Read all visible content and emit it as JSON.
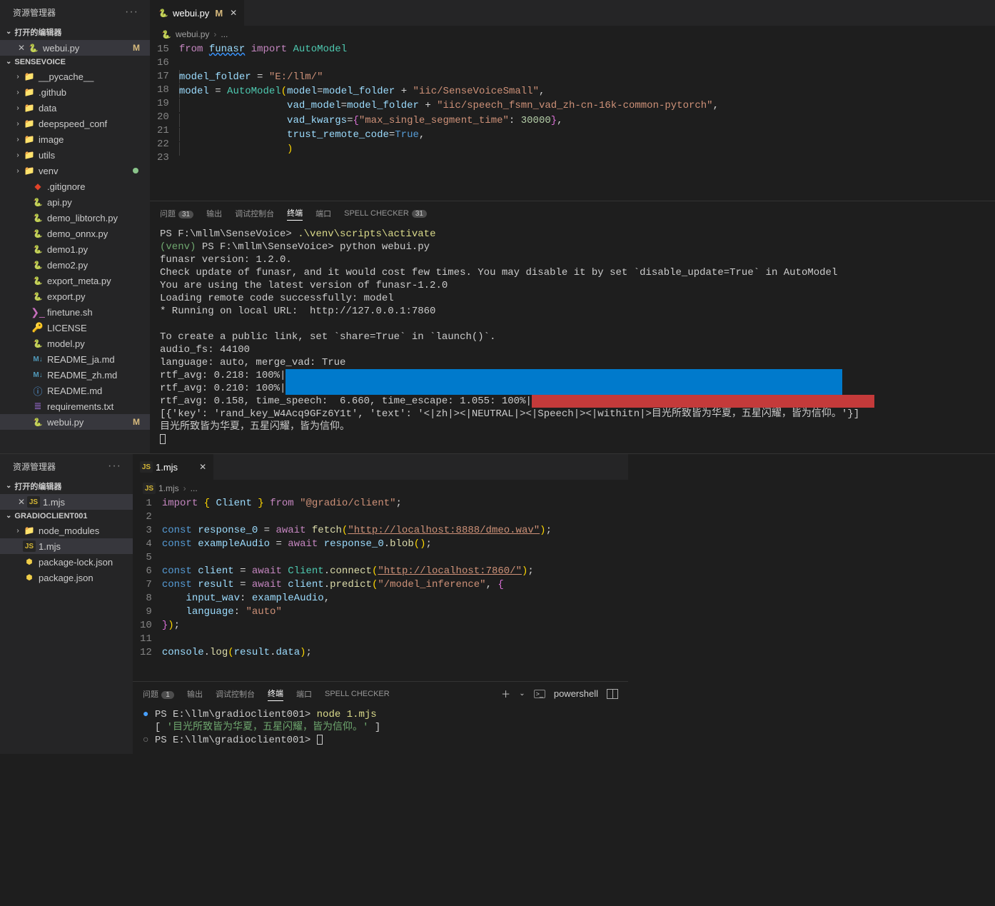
{
  "win1": {
    "sidebar": {
      "title": "资源管理器",
      "section_open_editors": "打开的编辑器",
      "project_name": "SENSEVOICE",
      "open_editors": [
        {
          "name": "webui.py",
          "badge": "M",
          "active": true
        }
      ],
      "tree": [
        {
          "depth": 1,
          "chev": "›",
          "icon": "folder-y",
          "name": "__pycache__"
        },
        {
          "depth": 1,
          "chev": "›",
          "icon": "folder-grey",
          "name": ".github"
        },
        {
          "depth": 1,
          "chev": "›",
          "icon": "folder-y",
          "name": "data"
        },
        {
          "depth": 1,
          "chev": "›",
          "icon": "folder-grey",
          "name": "deepspeed_conf"
        },
        {
          "depth": 1,
          "chev": "›",
          "icon": "folder-g",
          "name": "image"
        },
        {
          "depth": 1,
          "chev": "›",
          "icon": "folder-g",
          "name": "utils"
        },
        {
          "depth": 1,
          "chev": "›",
          "icon": "folder-g",
          "name": "venv",
          "dot": true
        },
        {
          "depth": 2,
          "chev": "",
          "icon": "git",
          "name": ".gitignore"
        },
        {
          "depth": 2,
          "chev": "",
          "icon": "py",
          "name": "api.py"
        },
        {
          "depth": 2,
          "chev": "",
          "icon": "py",
          "name": "demo_libtorch.py"
        },
        {
          "depth": 2,
          "chev": "",
          "icon": "py",
          "name": "demo_onnx.py"
        },
        {
          "depth": 2,
          "chev": "",
          "icon": "py",
          "name": "demo1.py"
        },
        {
          "depth": 2,
          "chev": "",
          "icon": "py",
          "name": "demo2.py"
        },
        {
          "depth": 2,
          "chev": "",
          "icon": "py",
          "name": "export_meta.py"
        },
        {
          "depth": 2,
          "chev": "",
          "icon": "py",
          "name": "export.py"
        },
        {
          "depth": 2,
          "chev": "",
          "icon": "sh",
          "name": "finetune.sh"
        },
        {
          "depth": 2,
          "chev": "",
          "icon": "lic",
          "name": "LICENSE"
        },
        {
          "depth": 2,
          "chev": "",
          "icon": "py",
          "name": "model.py"
        },
        {
          "depth": 2,
          "chev": "",
          "icon": "md",
          "name": "README_ja.md"
        },
        {
          "depth": 2,
          "chev": "",
          "icon": "md",
          "name": "README_zh.md"
        },
        {
          "depth": 2,
          "chev": "",
          "icon": "info",
          "name": "README.md"
        },
        {
          "depth": 2,
          "chev": "",
          "icon": "txt",
          "name": "requirements.txt"
        },
        {
          "depth": 2,
          "chev": "",
          "icon": "py",
          "name": "webui.py",
          "badge": "M",
          "selected": true
        }
      ]
    },
    "tab": {
      "name": "webui.py",
      "badge": "M"
    },
    "breadcrumb": {
      "a": "webui.py",
      "b": "..."
    },
    "code_start_line": 15,
    "panel": {
      "tabs": {
        "problems": "问题",
        "problems_count": "31",
        "output": "输出",
        "debug": "调试控制台",
        "terminal": "终端",
        "ports": "端口",
        "spell": "SPELL CHECKER",
        "spell_count": "31"
      },
      "term": {
        "l1_a": "PS F:\\mllm\\SenseVoice> ",
        "l1_b": ".\\venv\\scripts\\activate",
        "l2_a": "(venv) ",
        "l2_b": "PS F:\\mllm\\SenseVoice> python webui.py",
        "l3": "funasr version: 1.2.0.",
        "l4": "Check update of funasr, and it would cost few times. You may disable it by set `disable_update=True` in AutoModel",
        "l5": "You are using the latest version of funasr-1.2.0",
        "l6": "Loading remote code successfully: model",
        "l7": "* Running on local URL:  http://127.0.0.1:7860",
        "l8": "To create a public link, set `share=True` in `launch()`.",
        "l9": "audio_fs: 44100",
        "l10": "language: auto, merge_vad: True",
        "l11": "rtf_avg: 0.218: 100%|",
        "l12": "rtf_avg: 0.210: 100%|",
        "l13": "rtf_avg: 0.158, time_speech:  6.660, time_escape: 1.055: 100%|",
        "l14": "[{'key': 'rand_key_W4Acq9GFz6Y1t', 'text': '<|zh|><|NEUTRAL|><|Speech|><|withitn|>目光所致皆为华夏，五星闪耀，皆为信仰。'}]",
        "l15": "目光所致皆为华夏，五星闪耀，皆为信仰。"
      }
    }
  },
  "win2": {
    "sidebar": {
      "title": "资源管理器",
      "section_open_editors": "打开的编辑器",
      "project_name": "GRADIOCLIENT001",
      "open_editors": [
        {
          "name": "1.mjs",
          "active": true
        }
      ],
      "tree": [
        {
          "depth": 1,
          "chev": "›",
          "icon": "folder-g",
          "name": "node_modules"
        },
        {
          "depth": 1,
          "chev": "",
          "icon": "js",
          "name": "1.mjs",
          "selected": true
        },
        {
          "depth": 1,
          "chev": "",
          "icon": "json",
          "name": "package-lock.json"
        },
        {
          "depth": 1,
          "chev": "",
          "icon": "json",
          "name": "package.json"
        }
      ]
    },
    "tab": {
      "name": "1.mjs"
    },
    "breadcrumb": {
      "a": "1.mjs",
      "b": "..."
    },
    "panel": {
      "tabs": {
        "problems": "问题",
        "problems_count": "1",
        "output": "输出",
        "debug": "调试控制台",
        "terminal": "终端",
        "ports": "端口",
        "spell": "SPELL CHECKER"
      },
      "shell_label": "powershell",
      "term": {
        "l1_a": "PS E:\\llm\\gradioclient001> ",
        "l1_b": "node 1.mjs",
        "l2_a": "[ ",
        "l2_b": "'目光所致皆为华夏，五星闪耀，皆为信仰。'",
        "l2_c": " ]",
        "l3": "PS E:\\llm\\gradioclient001> "
      }
    }
  }
}
